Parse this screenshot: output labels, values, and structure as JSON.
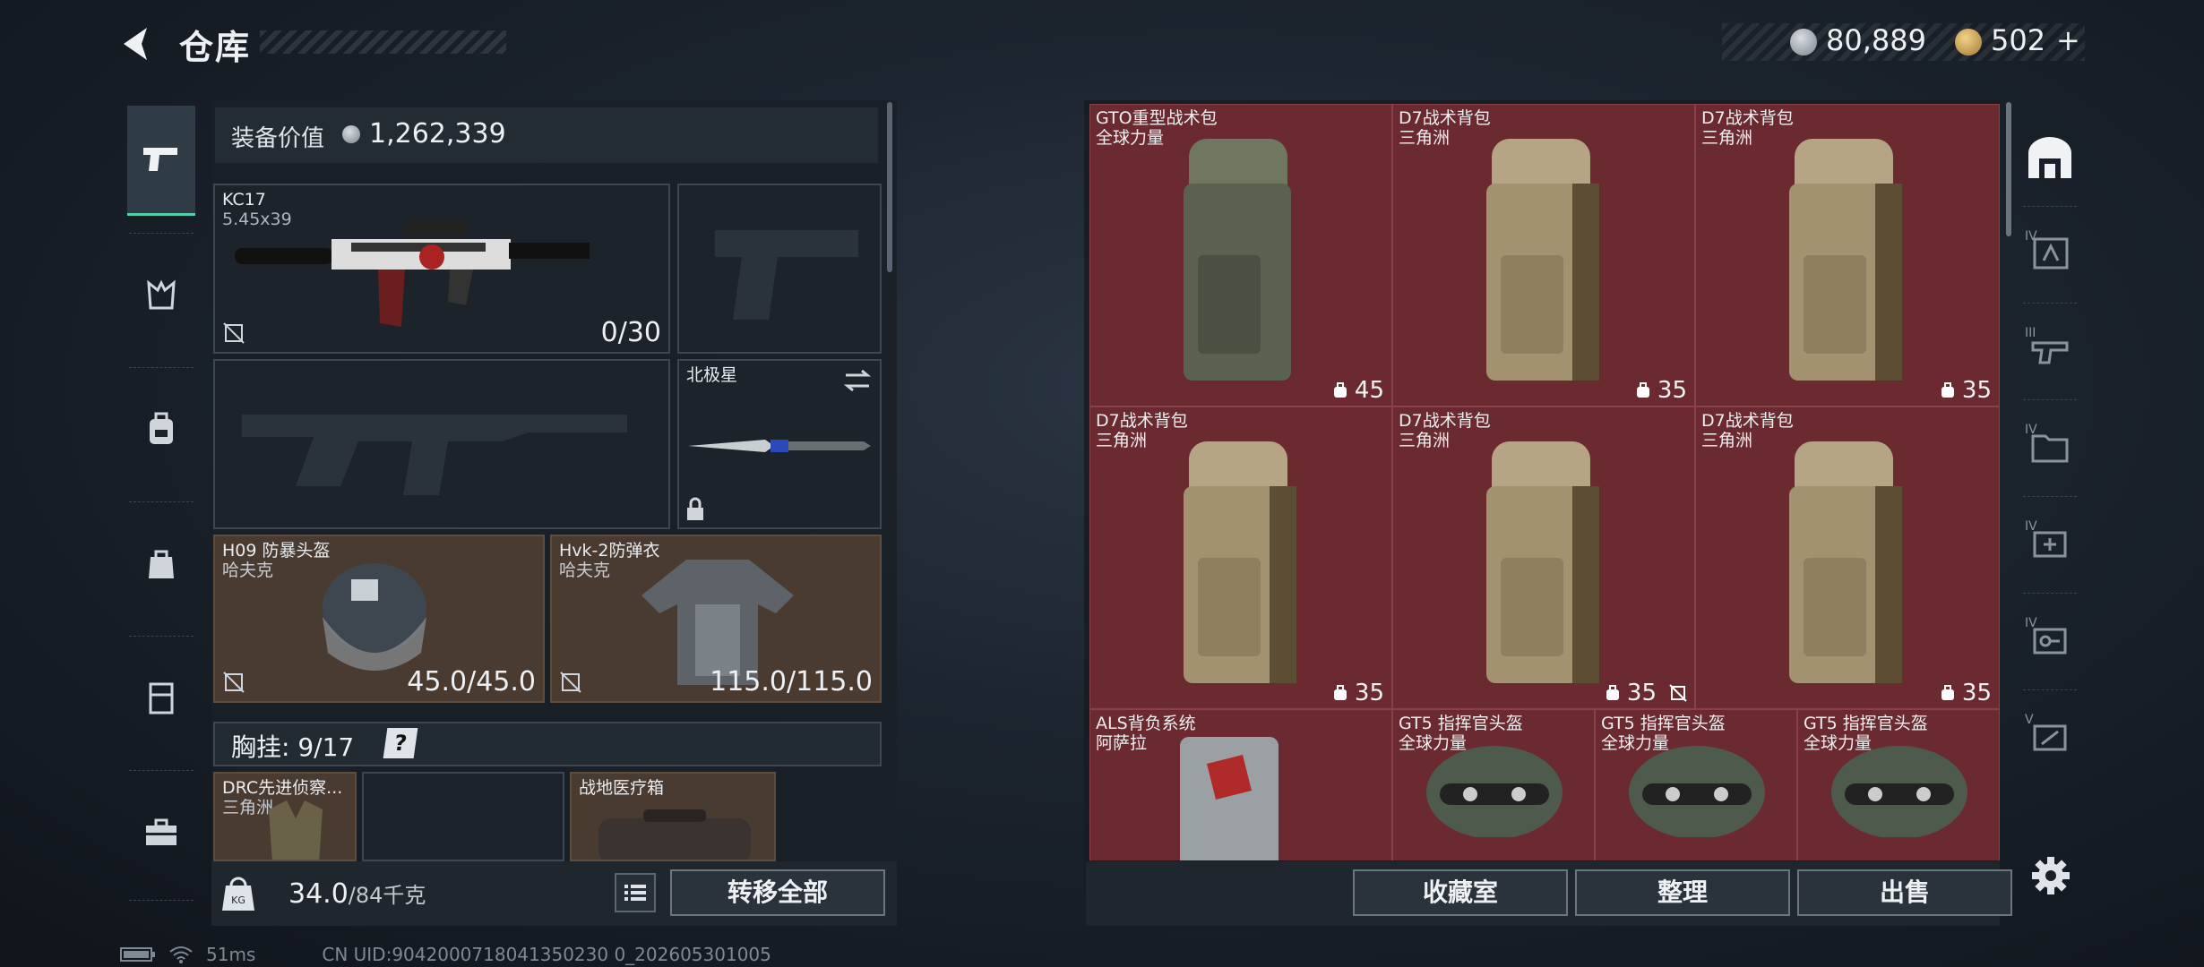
{
  "header": {
    "title": "仓库",
    "currency_silver": "80,889",
    "currency_gold": "502",
    "gold_plus": "+"
  },
  "equipment": {
    "value_label": "装备价值",
    "value": "1,262,339",
    "primary_weapon": {
      "name": "KC17",
      "ammo_type": "5.45x39",
      "ammo": "0/30"
    },
    "melee": {
      "name": "北极星"
    },
    "helmet": {
      "name": "H09 防暴头盔",
      "brand": "哈夫克",
      "durability": "45.0/45.0"
    },
    "armor": {
      "name": "Hvk-2防弹衣",
      "brand": "哈夫克",
      "durability": "115.0/115.0"
    },
    "chest": {
      "label": "胸挂:",
      "count": "9/17",
      "help": "?"
    },
    "chest_items": [
      {
        "name": "DRC先进侦察...",
        "brand": "三角洲"
      },
      {
        "name": "战地医疗箱"
      }
    ],
    "weight": "34.0",
    "weight_max": "/84千克",
    "transfer_all": "转移全部"
  },
  "storage": {
    "items": [
      {
        "name": "GTO重型战术包",
        "brand": "全球力量",
        "capacity": "45"
      },
      {
        "name": "D7战术背包",
        "brand": "三角洲",
        "capacity": "35"
      },
      {
        "name": "D7战术背包",
        "brand": "三角洲",
        "capacity": "35"
      },
      {
        "name": "D7战术背包",
        "brand": "三角洲",
        "capacity": "35"
      },
      {
        "name": "D7战术背包",
        "brand": "三角洲",
        "capacity": "35"
      },
      {
        "name": "D7战术背包",
        "brand": "三角洲",
        "capacity": "35"
      },
      {
        "name": "ALS背负系统",
        "brand": "阿萨拉"
      },
      {
        "name": "GT5 指挥官头盔",
        "brand": "全球力量"
      },
      {
        "name": "GT5 指挥官头盔",
        "brand": "全球力量"
      },
      {
        "name": "GT5 指挥官头盔",
        "brand": "全球力量"
      }
    ],
    "buttons": {
      "collection": "收藏室",
      "organize": "整理",
      "sell": "出售"
    }
  },
  "right_tabs": [
    "IV",
    "III",
    "IV",
    "IV",
    "IV",
    "V"
  ],
  "status": {
    "ping": "51ms",
    "uid": "CN UID:9042000718041350230 0_202605301005"
  },
  "colors": {
    "accent": "#4fd2a8",
    "storage_bg": "#6a2a30",
    "equip_bg": "#4a3b30"
  }
}
